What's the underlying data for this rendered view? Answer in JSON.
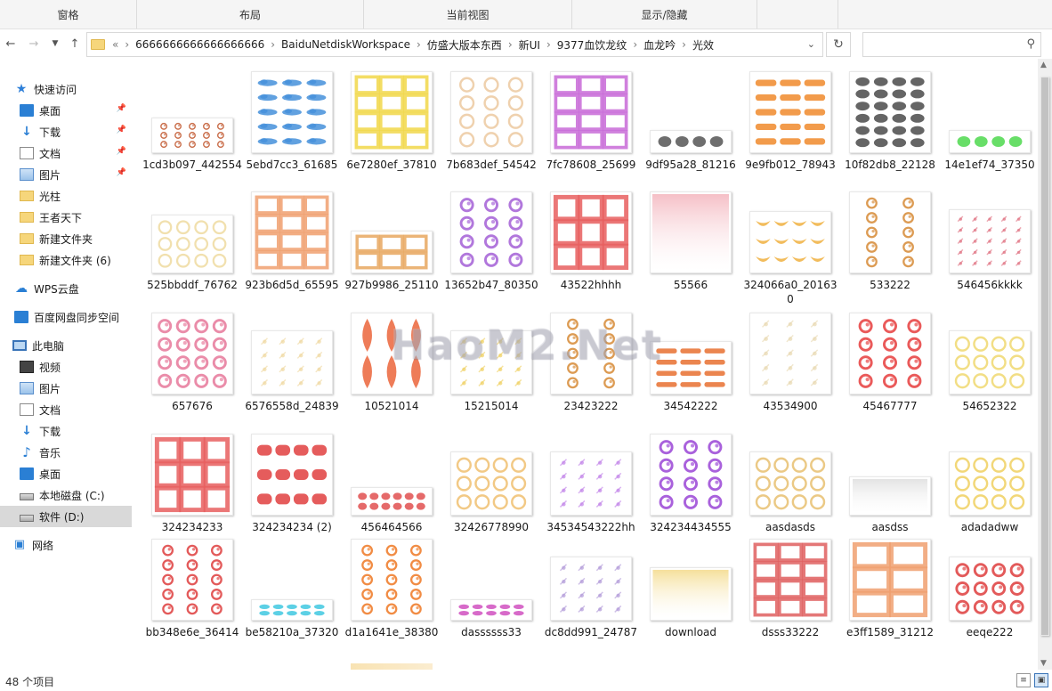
{
  "ribbon": {
    "tabs": [
      "窗格",
      "布局",
      "当前视图",
      "显示/隐藏"
    ]
  },
  "address": {
    "overflow": "«",
    "crumbs": [
      "6666666666666666666",
      "BaiduNetdiskWorkspace",
      "仿盛大版本东西",
      "新UI",
      "9377血饮龙纹",
      "血龙吟",
      "光效"
    ]
  },
  "search": {
    "placeholder": "",
    "value": ""
  },
  "sidebar": {
    "items": [
      {
        "label": "快速访问",
        "icon": "star-icon",
        "pinned": false
      },
      {
        "label": "桌面",
        "icon": "desktop-icon",
        "pinned": true
      },
      {
        "label": "下载",
        "icon": "download-icon",
        "pinned": true
      },
      {
        "label": "文档",
        "icon": "document-icon",
        "pinned": true
      },
      {
        "label": "图片",
        "icon": "picture-icon",
        "pinned": true
      },
      {
        "label": "光柱",
        "icon": "folder-icon",
        "pinned": false
      },
      {
        "label": "王者天下",
        "icon": "folder-icon",
        "pinned": false
      },
      {
        "label": "新建文件夹",
        "icon": "folder-icon",
        "pinned": false
      },
      {
        "label": "新建文件夹 (6)",
        "icon": "folder-icon",
        "pinned": false
      },
      {
        "label": "WPS云盘",
        "icon": "cloud-icon",
        "pinned": false
      },
      {
        "label": "百度网盘同步空间",
        "icon": "baidu-sync-icon",
        "pinned": false
      },
      {
        "label": "此电脑",
        "icon": "computer-icon",
        "pinned": false
      },
      {
        "label": "视频",
        "icon": "video-icon",
        "pinned": false
      },
      {
        "label": "图片",
        "icon": "picture-icon",
        "pinned": false
      },
      {
        "label": "文档",
        "icon": "document-icon",
        "pinned": false
      },
      {
        "label": "下载",
        "icon": "download-icon",
        "pinned": false
      },
      {
        "label": "音乐",
        "icon": "music-icon",
        "pinned": false
      },
      {
        "label": "桌面",
        "icon": "desktop-icon",
        "pinned": false
      },
      {
        "label": "本地磁盘 (C:)",
        "icon": "drive-icon",
        "pinned": false
      },
      {
        "label": "软件 (D:)",
        "icon": "drive-icon",
        "pinned": false,
        "selected": true
      },
      {
        "label": "网络",
        "icon": "network-icon",
        "pinned": false
      }
    ]
  },
  "files": [
    {
      "name": "1cd3b097_442554",
      "color": "#c4603a",
      "kind": "swirl",
      "rows": 3,
      "cols": 5
    },
    {
      "name": "5ebd7cc3_61685",
      "color": "#3a8ad8",
      "kind": "cloud",
      "rows": 5,
      "cols": 3
    },
    {
      "name": "6e7280ef_37810",
      "color": "#f2d84a",
      "kind": "grid",
      "rows": 4,
      "cols": 3
    },
    {
      "name": "7b683def_54542",
      "color": "#ecc9a0",
      "kind": "ring",
      "rows": 4,
      "cols": 3
    },
    {
      "name": "7fc78608_25699",
      "color": "#c86ad8",
      "kind": "grid",
      "rows": 4,
      "cols": 3
    },
    {
      "name": "9df95a28_81216",
      "color": "#555555",
      "kind": "blob",
      "rows": 1,
      "cols": 4
    },
    {
      "name": "9e9fb012_78943",
      "color": "#f08a2c",
      "kind": "bar",
      "rows": 5,
      "cols": 3
    },
    {
      "name": "10f82db8_22128",
      "color": "#4a4a4a",
      "kind": "blob",
      "rows": 6,
      "cols": 4
    },
    {
      "name": "14e1ef74_37350",
      "color": "#4ed84e",
      "kind": "blob",
      "rows": 1,
      "cols": 4
    },
    {
      "name": "525bbddf_76762",
      "color": "#eedba0",
      "kind": "ring",
      "rows": 3,
      "cols": 4
    },
    {
      "name": "923b6d5d_65595",
      "color": "#f0a070",
      "kind": "grid",
      "rows": 4,
      "cols": 3
    },
    {
      "name": "927b9986_25110",
      "color": "#e8a860",
      "kind": "grid",
      "rows": 2,
      "cols": 3
    },
    {
      "name": "13652b47_80350",
      "color": "#a868d8",
      "kind": "swirl",
      "rows": 4,
      "cols": 3
    },
    {
      "name": "43522hhhh",
      "color": "#e86060",
      "kind": "grid",
      "rows": 3,
      "cols": 3
    },
    {
      "name": "55566",
      "color": "#f4b8c0",
      "kind": "fade",
      "rows": 1,
      "cols": 1
    },
    {
      "name": "324066a0_201630",
      "color": "#f0b040",
      "kind": "wing",
      "rows": 3,
      "cols": 4
    },
    {
      "name": "533222",
      "color": "#d89040",
      "kind": "swirl",
      "rows": 5,
      "cols": 2
    },
    {
      "name": "546456kkkk",
      "color": "#e07080",
      "kind": "spark",
      "rows": 5,
      "cols": 5
    },
    {
      "name": "657676",
      "color": "#e880a0",
      "kind": "swirl",
      "rows": 4,
      "cols": 4
    },
    {
      "name": "6576558d_24839",
      "color": "#f0d8a0",
      "kind": "spark",
      "rows": 4,
      "cols": 4
    },
    {
      "name": "10521014",
      "color": "#e85020",
      "kind": "flame",
      "rows": 2,
      "cols": 3
    },
    {
      "name": "15215014",
      "color": "#f0d060",
      "kind": "spark",
      "rows": 4,
      "cols": 4
    },
    {
      "name": "23423222",
      "color": "#d89040",
      "kind": "swirl",
      "rows": 5,
      "cols": 2
    },
    {
      "name": "34542222",
      "color": "#e87030",
      "kind": "bar",
      "rows": 4,
      "cols": 3
    },
    {
      "name": "43534900",
      "color": "#e8d8b0",
      "kind": "spark",
      "rows": 5,
      "cols": 3
    },
    {
      "name": "45467777",
      "color": "#e84848",
      "kind": "swirl",
      "rows": 4,
      "cols": 3
    },
    {
      "name": "54652322",
      "color": "#f0d870",
      "kind": "ring",
      "rows": 3,
      "cols": 4
    },
    {
      "name": "324234233",
      "color": "#e86060",
      "kind": "grid",
      "rows": 3,
      "cols": 3
    },
    {
      "name": "324234234 (2)",
      "color": "#e04040",
      "kind": "bar",
      "rows": 3,
      "cols": 4
    },
    {
      "name": "456464566",
      "color": "#e05050",
      "kind": "blob",
      "rows": 2,
      "cols": 6
    },
    {
      "name": "32426778990",
      "color": "#f0c070",
      "kind": "ring",
      "rows": 3,
      "cols": 4
    },
    {
      "name": "34534543222hh",
      "color": "#c080e8",
      "kind": "spark",
      "rows": 4,
      "cols": 4
    },
    {
      "name": "324234434555",
      "color": "#a050d8",
      "kind": "swirl",
      "rows": 4,
      "cols": 3
    },
    {
      "name": "aasdasds",
      "color": "#e8c070",
      "kind": "ring",
      "rows": 3,
      "cols": 4
    },
    {
      "name": "aasdss",
      "color": "#e0e0e0",
      "kind": "fade",
      "rows": 1,
      "cols": 1
    },
    {
      "name": "adadadww",
      "color": "#f0d060",
      "kind": "ring",
      "rows": 3,
      "cols": 4
    },
    {
      "name": "bb348e6e_36414",
      "color": "#e04848",
      "kind": "swirl",
      "rows": 5,
      "cols": 3
    },
    {
      "name": "be58210a_37320",
      "color": "#40c8e0",
      "kind": "blob",
      "rows": 2,
      "cols": 5
    },
    {
      "name": "d1a1641e_38380",
      "color": "#f08030",
      "kind": "swirl",
      "rows": 5,
      "cols": 3
    },
    {
      "name": "dassssss33",
      "color": "#d050c0",
      "kind": "blob",
      "rows": 2,
      "cols": 5
    },
    {
      "name": "dc8dd991_24787",
      "color": "#b098d8",
      "kind": "spark",
      "rows": 4,
      "cols": 4
    },
    {
      "name": "download",
      "color": "#f4dc90",
      "kind": "fade",
      "rows": 1,
      "cols": 1
    },
    {
      "name": "dsss33222",
      "color": "#e06060",
      "kind": "grid",
      "rows": 4,
      "cols": 3
    },
    {
      "name": "e3ff1589_31212",
      "color": "#f0a070",
      "kind": "grid",
      "rows": 3,
      "cols": 2
    },
    {
      "name": "eeqe222",
      "color": "#e04848",
      "kind": "swirl",
      "rows": 3,
      "cols": 4
    }
  ],
  "status": {
    "count_text": "48 个项目"
  },
  "watermark": "HaoM2.Net"
}
